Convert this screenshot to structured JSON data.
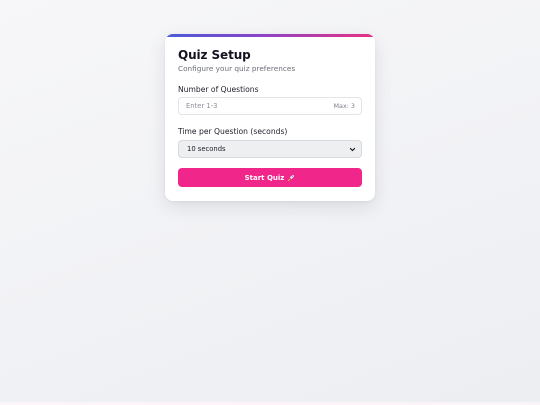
{
  "quiz_setup": {
    "title": "Quiz Setup",
    "subtitle": "Configure your quiz preferences",
    "questions_label": "Number of Questions",
    "questions_input": {
      "value": "",
      "placeholder": "Enter 1-3",
      "max_hint": "Max: 3"
    },
    "time_label": "Time per Question (seconds)",
    "time_select": {
      "selected": "10 seconds"
    },
    "start_button_label": "Start Quiz",
    "start_button_icon": "rocket-icon"
  },
  "colors": {
    "accent": "#f0268a",
    "gradient_start": "#4b5bd6",
    "gradient_end": "#e9317f"
  }
}
